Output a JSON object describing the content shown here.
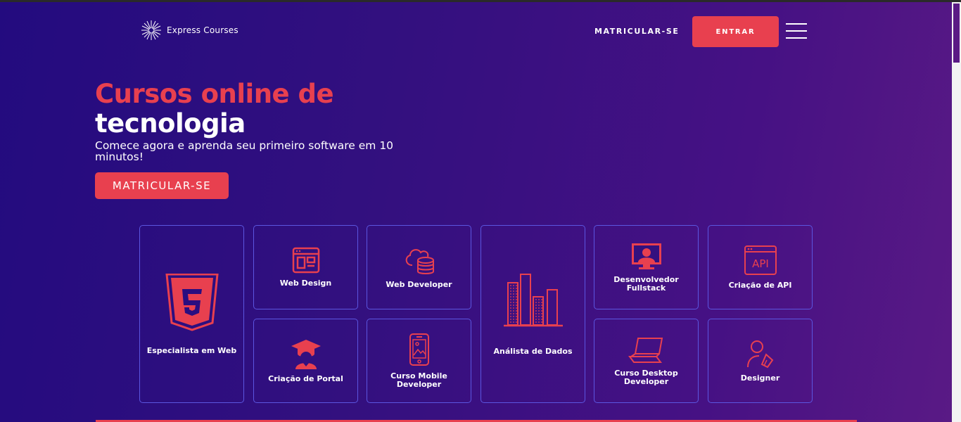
{
  "header": {
    "logo_text": "Express Courses",
    "nav_enroll": "MATRICULAR-SE",
    "login_button": "ENTRAR"
  },
  "hero": {
    "title_line1": "Cursos online de",
    "title_line2": "tecnologia",
    "subtitle": "Comece agora e aprenda seu primeiro software em 10 minutos!",
    "cta_button": "MATRICULAR-SE"
  },
  "courses": [
    {
      "label": "Especialista em Web",
      "icon": "html5-icon"
    },
    {
      "label": "Web Design",
      "icon": "web-layout-icon"
    },
    {
      "label": "Web Developer",
      "icon": "cloud-database-icon"
    },
    {
      "label": "Análista de Dados",
      "icon": "bar-chart-icon"
    },
    {
      "label": "Desenvolvedor Fullstack",
      "icon": "monitor-user-icon"
    },
    {
      "label": "Criação de API",
      "icon": "api-window-icon"
    },
    {
      "label": "Criação de Portal",
      "icon": "graduate-icon"
    },
    {
      "label": "Curso Mobile Developer",
      "icon": "mobile-phone-icon"
    },
    {
      "label": "Curso Desktop Developer",
      "icon": "laptop-icon"
    },
    {
      "label": "Designer",
      "icon": "designer-pen-icon"
    }
  ],
  "colors": {
    "accent": "#e8404f",
    "card_border": "#5b56e0",
    "bg_start": "#230b7f",
    "bg_end": "#5a1a85"
  }
}
